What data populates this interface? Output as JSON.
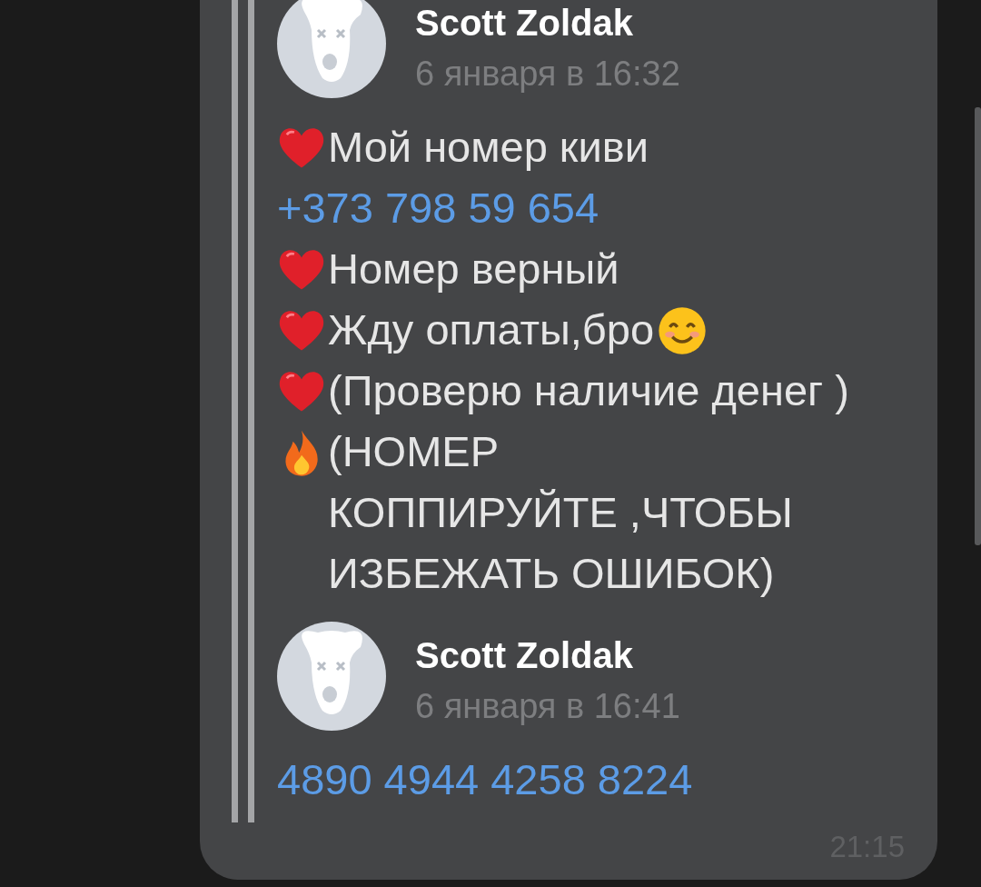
{
  "messages": [
    {
      "author": "Scott Zoldak",
      "date": "6 января в 16:32",
      "lines": [
        {
          "kind": "heart",
          "text": "Мой номер киви"
        },
        {
          "kind": "link",
          "text": "+373 798 59 654"
        },
        {
          "kind": "heart",
          "text": "Номер верный"
        },
        {
          "kind": "heartsmile",
          "text": "Жду оплаты,бро"
        },
        {
          "kind": "heart",
          "text": "(Проверю наличие денег )"
        },
        {
          "kind": "fire",
          "text": "(НОМЕР\nКОППИРУЙТЕ ,ЧТОБЫ\nИЗБЕЖАТЬ ОШИБОК)"
        }
      ]
    },
    {
      "author": "Scott Zoldak",
      "date": "6 января в 16:41",
      "lines": [
        {
          "kind": "link",
          "text": "4890 4944 4258 8224"
        }
      ]
    }
  ],
  "time": "21:15"
}
